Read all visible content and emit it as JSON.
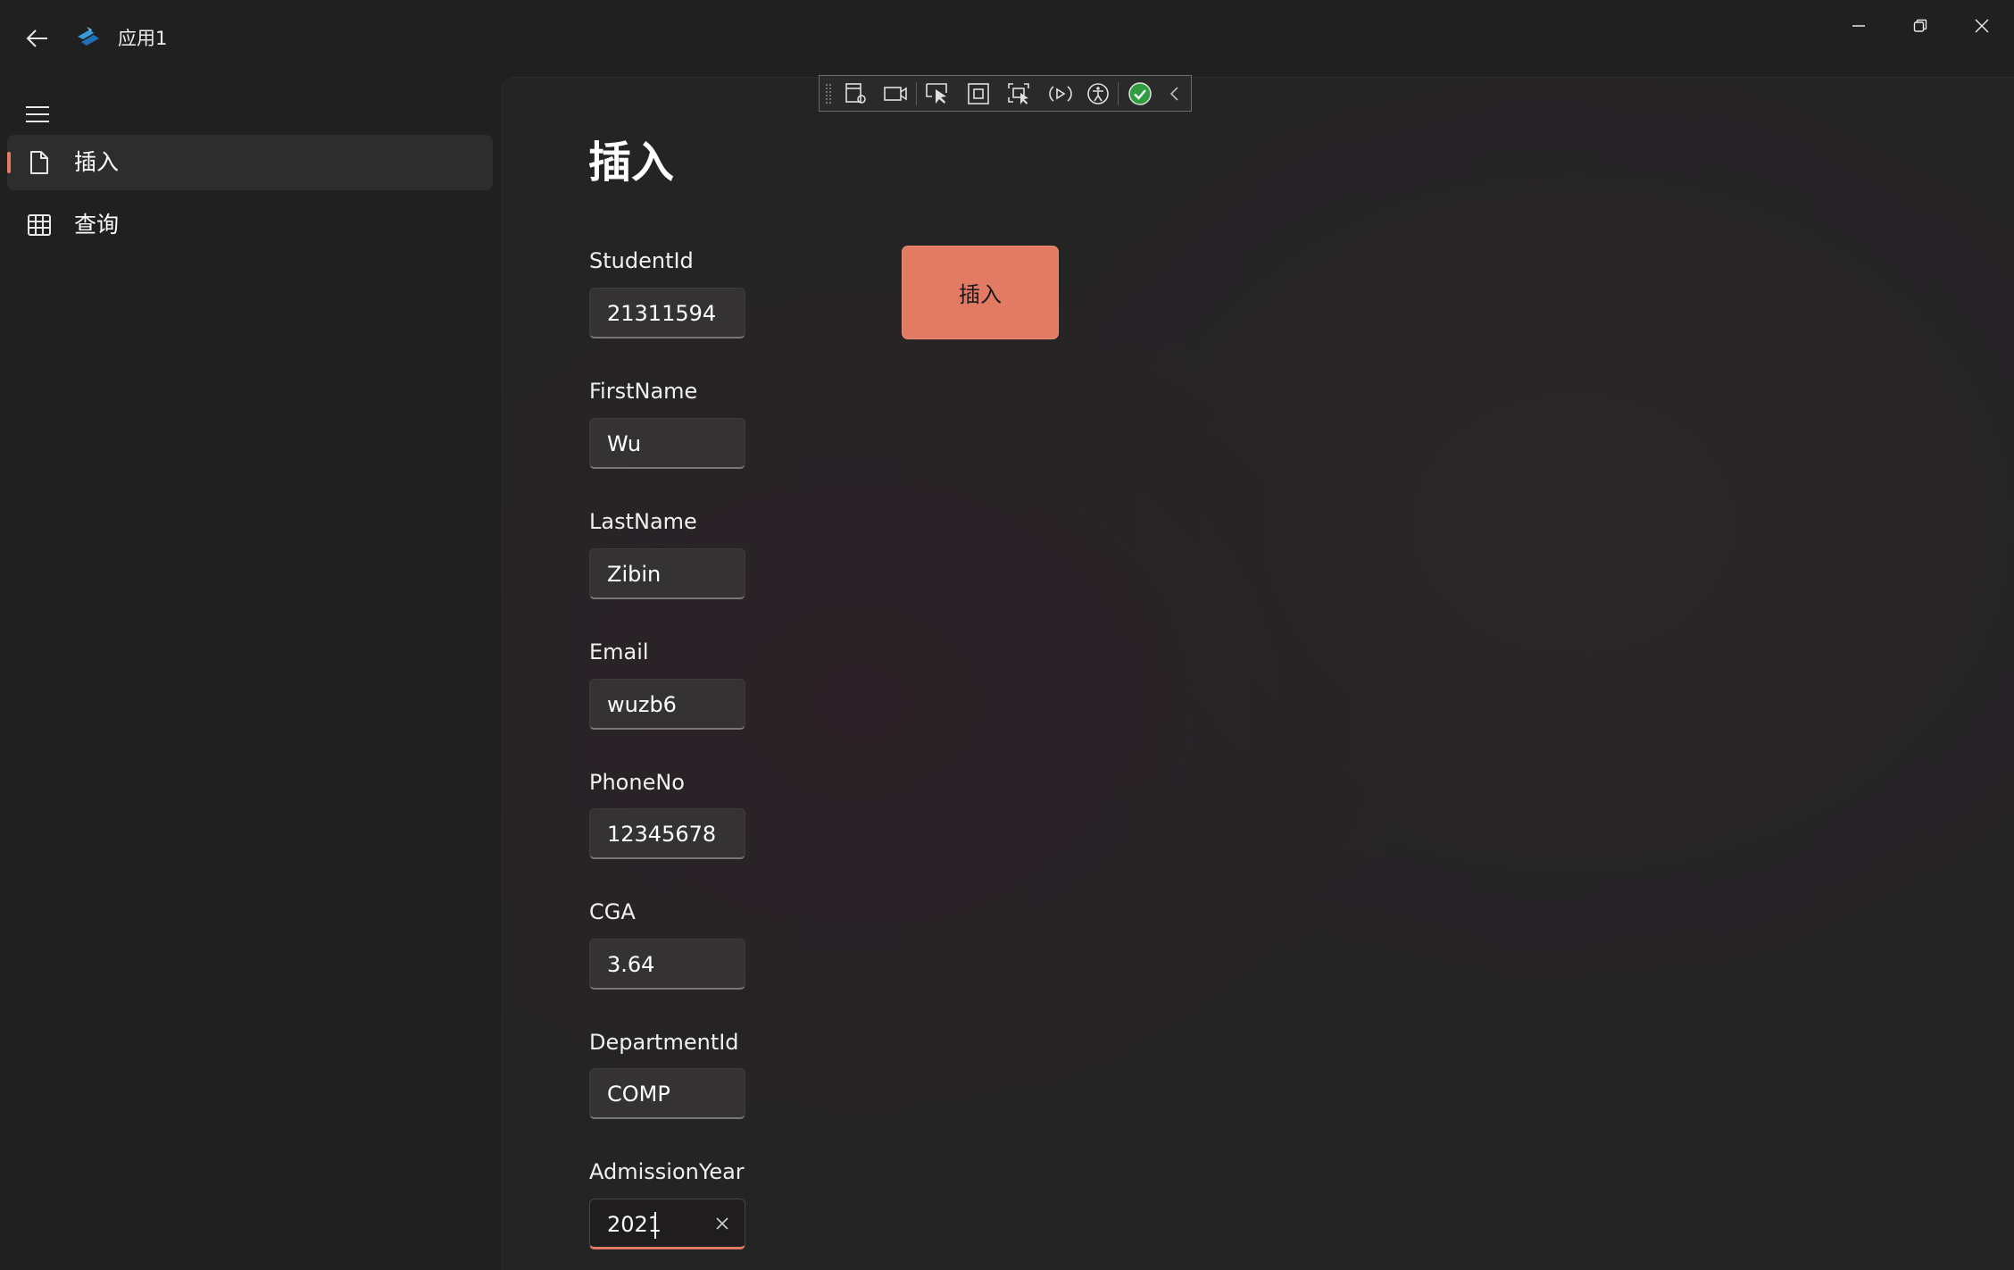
{
  "window": {
    "title": "应用1"
  },
  "sidebar": {
    "items": [
      {
        "label": "插入",
        "icon": "document-icon",
        "selected": true
      },
      {
        "label": "查询",
        "icon": "grid-icon",
        "selected": false
      }
    ]
  },
  "page": {
    "title": "插入"
  },
  "form": {
    "fields": [
      {
        "label": "StudentId",
        "value": "21311594"
      },
      {
        "label": "FirstName",
        "value": "Wu"
      },
      {
        "label": "LastName",
        "value": "Zibin"
      },
      {
        "label": "Email",
        "value": "wuzb6"
      },
      {
        "label": "PhoneNo",
        "value": "12345678"
      },
      {
        "label": "CGA",
        "value": "3.64"
      },
      {
        "label": "DepartmentId",
        "value": "COMP"
      },
      {
        "label": "AdmissionYear",
        "value": "2021",
        "focused": true
      }
    ],
    "submit_label": "插入"
  },
  "colors": {
    "accent": "#e27a64",
    "background": "#202020",
    "content_background": "#252425"
  }
}
